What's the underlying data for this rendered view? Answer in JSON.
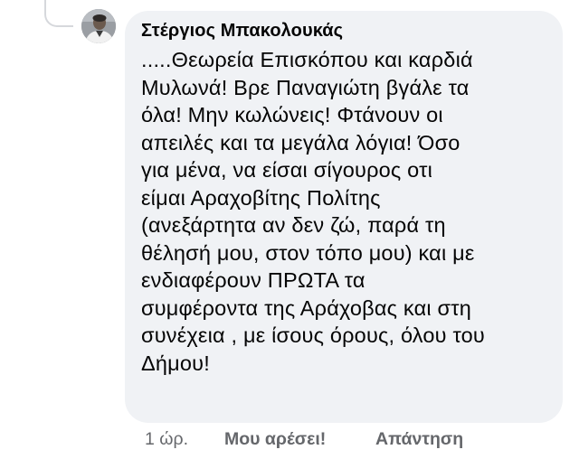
{
  "comment": {
    "author": "Στέργιος Μπακολουκάς",
    "text": ".....Θεωρεία Επισκόπου και καρδιά\nΜυλωνά! Βρε Παναγιώτη βγάλε τα\nόλα! Μην κωλώνεις! Φτάνουν οι\nαπειλές και τα μεγάλα λόγια! Όσο\nγια μένα, να είσαι σίγουρος οτι\nείμαι Αραχοβίτης Πολίτης\n(ανεξάρτητα αν δεν ζώ, παρά τη\nθέλησή μου, στον τόπο μου) και με\nενδιαφέρουν ΠΡΩΤΑ τα\nσυμφέροντα της Αράχοβας και στη\nσυνέχεια , με ίσους όρους, όλου του\nΔήμου!",
    "timestamp": "1 ώρ.",
    "like_label": "Μου αρέσει!",
    "reply_label": "Απάντηση"
  },
  "colors": {
    "bubble": "#f0f2f5",
    "text": "#050505",
    "secondary": "#65676b",
    "thread_line": "#d6d8dc"
  }
}
